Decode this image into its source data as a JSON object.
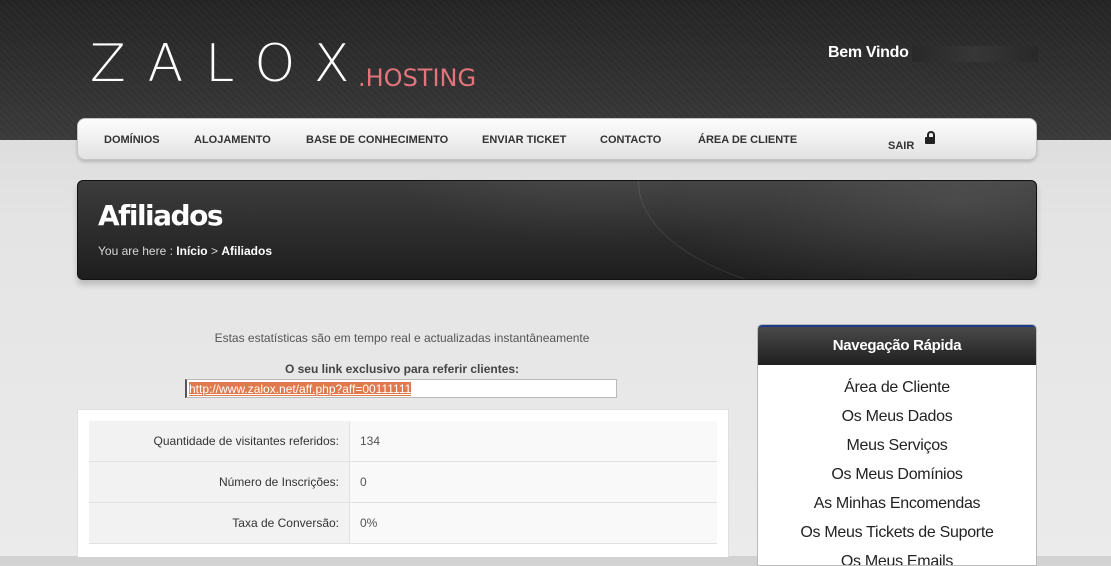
{
  "brand": {
    "logo_text": "ZALOX",
    "logo_suffix": ".HOSTING",
    "welcome": "Bem Vindo"
  },
  "nav": {
    "items": [
      {
        "label": "DOMÍNIOS"
      },
      {
        "label": "ALOJAMENTO"
      },
      {
        "label": "BASE DE CONHECIMENTO"
      },
      {
        "label": "ENVIAR TICKET"
      },
      {
        "label": "CONTACTO"
      },
      {
        "label": "ÁREA DE CLIENTE"
      }
    ],
    "logout": "SAIR",
    "logout_icon": "lock-icon"
  },
  "banner": {
    "title": "Afiliados",
    "breadcrumb_prefix": "You are here :",
    "breadcrumb_home": "Início",
    "breadcrumb_sep": ">",
    "breadcrumb_current": "Afiliados"
  },
  "affiliate": {
    "intro": "Estas estatísticas são em tempo real e actualizadas instantâneamente",
    "link_label": "O seu link exclusivo para referir clientes:",
    "link_value": "http://www.zalox.net/aff.php?aff=00111111",
    "stats": [
      {
        "label": "Quantidade de visitantes referidos:",
        "value": "134"
      },
      {
        "label": "Número de Inscrições:",
        "value": "0"
      },
      {
        "label": "Taxa de Conversão:",
        "value": "0%"
      }
    ]
  },
  "sidebar": {
    "title": "Navegação Rápida",
    "items": [
      {
        "label": "Área de Cliente"
      },
      {
        "label": "Os Meus Dados"
      },
      {
        "label": "Meus Serviços"
      },
      {
        "label": "Os Meus Domínios"
      },
      {
        "label": "As Minhas Encomendas"
      },
      {
        "label": "Os Meus Tickets de Suporte"
      },
      {
        "label": "Os Meus Emails"
      }
    ]
  },
  "colors": {
    "accent_pink": "#e2747b",
    "header_dark": "#2a2a2a",
    "selection_orange": "#e07a4c"
  }
}
